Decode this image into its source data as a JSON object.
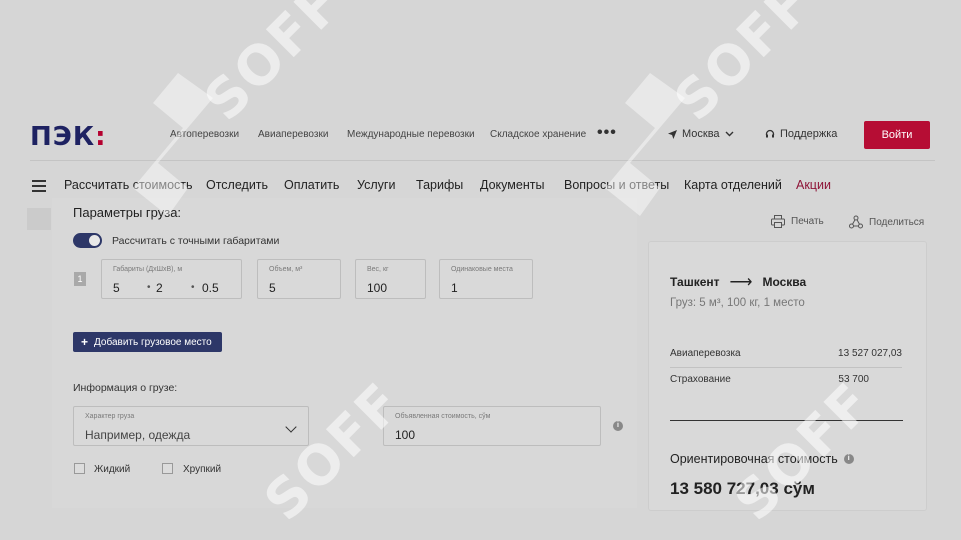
{
  "header": {
    "logo_text": "ПЭК",
    "logo_mark": ":",
    "nav": [
      "Автоперевозки",
      "Авиаперевозки",
      "Международные перевозки",
      "Складское хранение"
    ],
    "more": "•••",
    "city": "Москва",
    "support": "Поддержка",
    "login": "Войти"
  },
  "mainnav": [
    "Рассчитать стоимость",
    "Отследить",
    "Оплатить",
    "Услуги",
    "Тарифы",
    "Документы",
    "Вопросы и ответы",
    "Карта отделений",
    "Акции"
  ],
  "actions": {
    "print": "Печать",
    "share": "Поделиться"
  },
  "form": {
    "title": "Параметры груза:",
    "toggle_label": "Рассчитать с точными габаритами",
    "row_number": "1",
    "dims_label": "Габариты (ДхШхВ), м",
    "dims": [
      "5",
      "2",
      "0.5"
    ],
    "dim_sep": "•",
    "volume_label": "Объем, м³",
    "volume": "5",
    "weight_label": "Вес, кг",
    "weight": "100",
    "places_label": "Одинаковые места",
    "places": "1",
    "add_button": "Добавить грузовое место",
    "add_plus": "+",
    "info_title": "Информация о грузе:",
    "nature_label": "Характер груза",
    "nature_placeholder": "Например, одежда",
    "declared_label": "Объявленная стоимость, сўм",
    "declared_value": "100",
    "info_icon": "i",
    "liquid": "Жидкий",
    "fragile": "Хрупкий"
  },
  "summary": {
    "from": "Ташкент",
    "to": "Москва",
    "arrow": "⟶",
    "cargo": "Груз: 5 м³, 100 кг, 1 место",
    "rows": [
      {
        "label": "Авиаперевозка",
        "amount": "13 527 027,03"
      },
      {
        "label": "Страхование",
        "amount": "53 700"
      }
    ],
    "estimate_label": "Ориентировочная стоимость",
    "estimate_value": "13 580 727,03 сўм"
  },
  "watermark": "SOFF",
  "colors": {
    "brand": "#1e2262",
    "accent": "#b60d34",
    "primary": "#2d3768"
  }
}
